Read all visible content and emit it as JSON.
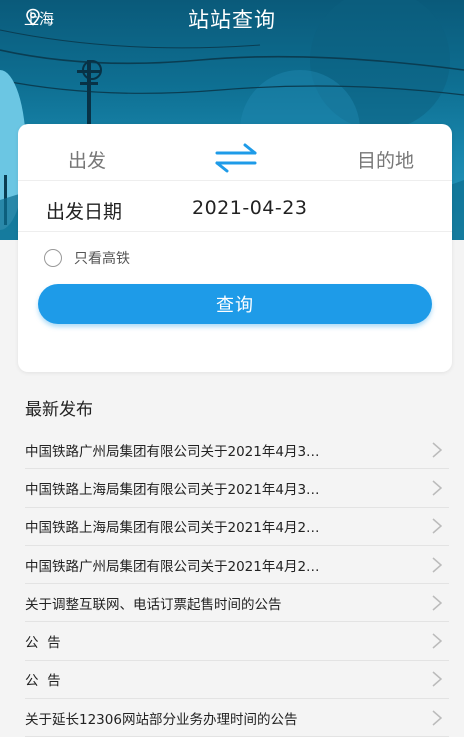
{
  "header": {
    "location": "上海",
    "title": "站站查询"
  },
  "search": {
    "origin_placeholder": "出发",
    "destination_placeholder": "目的地",
    "date_label": "出发日期",
    "date_value": "2021-04-23",
    "high_speed_only_label": "只看高铁",
    "high_speed_only_checked": false,
    "query_button": "查询"
  },
  "news": {
    "section_title": "最新发布",
    "items": [
      "中国铁路广州局集团有限公司关于2021年4月3…",
      "中国铁路上海局集团有限公司关于2021年4月3…",
      "中国铁路上海局集团有限公司关于2021年4月2…",
      "中国铁路广州局集团有限公司关于2021年4月2…",
      "关于调整互联网、电话订票起售时间的公告",
      "公  告",
      "公  告",
      "关于延长12306网站部分业务办理时间的公告"
    ]
  },
  "colors": {
    "accent": "#1e9be8",
    "banner": "#0e6f92"
  }
}
